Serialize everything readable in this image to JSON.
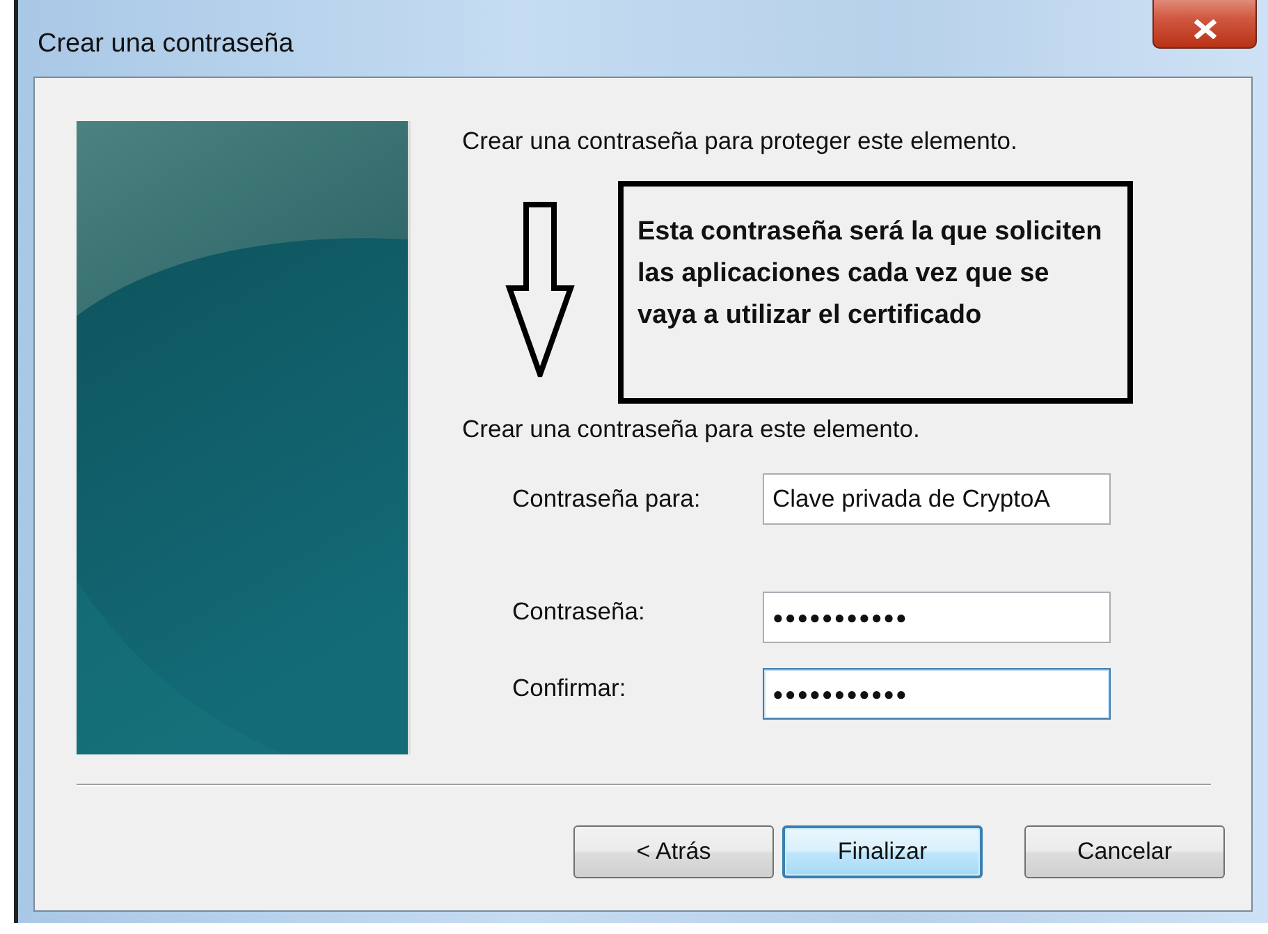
{
  "window": {
    "title": "Crear una contraseña"
  },
  "intro": "Crear una contraseña para proteger este elemento.",
  "annotation": {
    "text": "Esta contraseña será la que soliciten las aplicaciones cada vez que se vaya a utilizar el certificado"
  },
  "section_label": "Crear una contraseña para este elemento.",
  "fields": [
    {
      "label": "Contraseña para:",
      "value": "Clave privada de CryptoA",
      "focused": false
    },
    {
      "label": "Contraseña:",
      "value": "●●●●●●●●●●●",
      "focused": false
    },
    {
      "label": "Confirmar:",
      "value": "●●●●●●●●●●●",
      "focused": true
    }
  ],
  "buttons": [
    {
      "label": "< Atrás",
      "default": false
    },
    {
      "label": "Finalizar",
      "default": true
    },
    {
      "label": "Cancelar",
      "default": false
    }
  ]
}
